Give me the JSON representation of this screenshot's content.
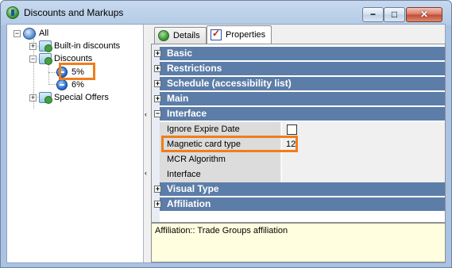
{
  "window": {
    "title": "Discounts and Markups",
    "controls": {
      "minimize": "−",
      "maximize": "□",
      "close": "✕"
    }
  },
  "tree": {
    "root": {
      "label": "All",
      "expander": "−"
    },
    "items": [
      {
        "label": "Built-in discounts",
        "expander": "+"
      },
      {
        "label": "Discounts",
        "expander": "−"
      },
      {
        "label": "5%"
      },
      {
        "label": "6%"
      },
      {
        "label": "Special Offers",
        "expander": "+"
      }
    ]
  },
  "splitter": {
    "arrow_top": "‹",
    "arrow_bottom": "‹"
  },
  "tabs": [
    {
      "label": "Details",
      "icon": "details-icon",
      "active": false
    },
    {
      "label": "Properties",
      "icon": "properties-icon",
      "active": true
    }
  ],
  "property_grid": {
    "categories": {
      "basic": {
        "label": "Basic",
        "toggle": "+"
      },
      "restrictions": {
        "label": "Restrictions",
        "toggle": "+"
      },
      "schedule": {
        "label": "Schedule (accessibility list)",
        "toggle": "+"
      },
      "main": {
        "label": "Main",
        "toggle": "+"
      },
      "interface": {
        "label": "Interface",
        "toggle": "−"
      },
      "visual_type": {
        "label": "Visual Type",
        "toggle": "+"
      },
      "affiliation": {
        "label": "Affiliation",
        "toggle": "+"
      }
    },
    "interface_props": [
      {
        "name": "Ignore Expire Date",
        "value": "",
        "type": "checkbox",
        "checked": false
      },
      {
        "name": "Magnetic card type",
        "value": "12",
        "type": "text"
      },
      {
        "name": "MCR Algorithm",
        "value": "",
        "type": "text"
      },
      {
        "name": "Interface",
        "value": "",
        "type": "text"
      }
    ]
  },
  "description": "Affiliation:: Trade Groups affiliation",
  "colors": {
    "category_bg": "#5c7da8",
    "highlight": "#f07d1c",
    "description_bg": "#ffffe0"
  }
}
